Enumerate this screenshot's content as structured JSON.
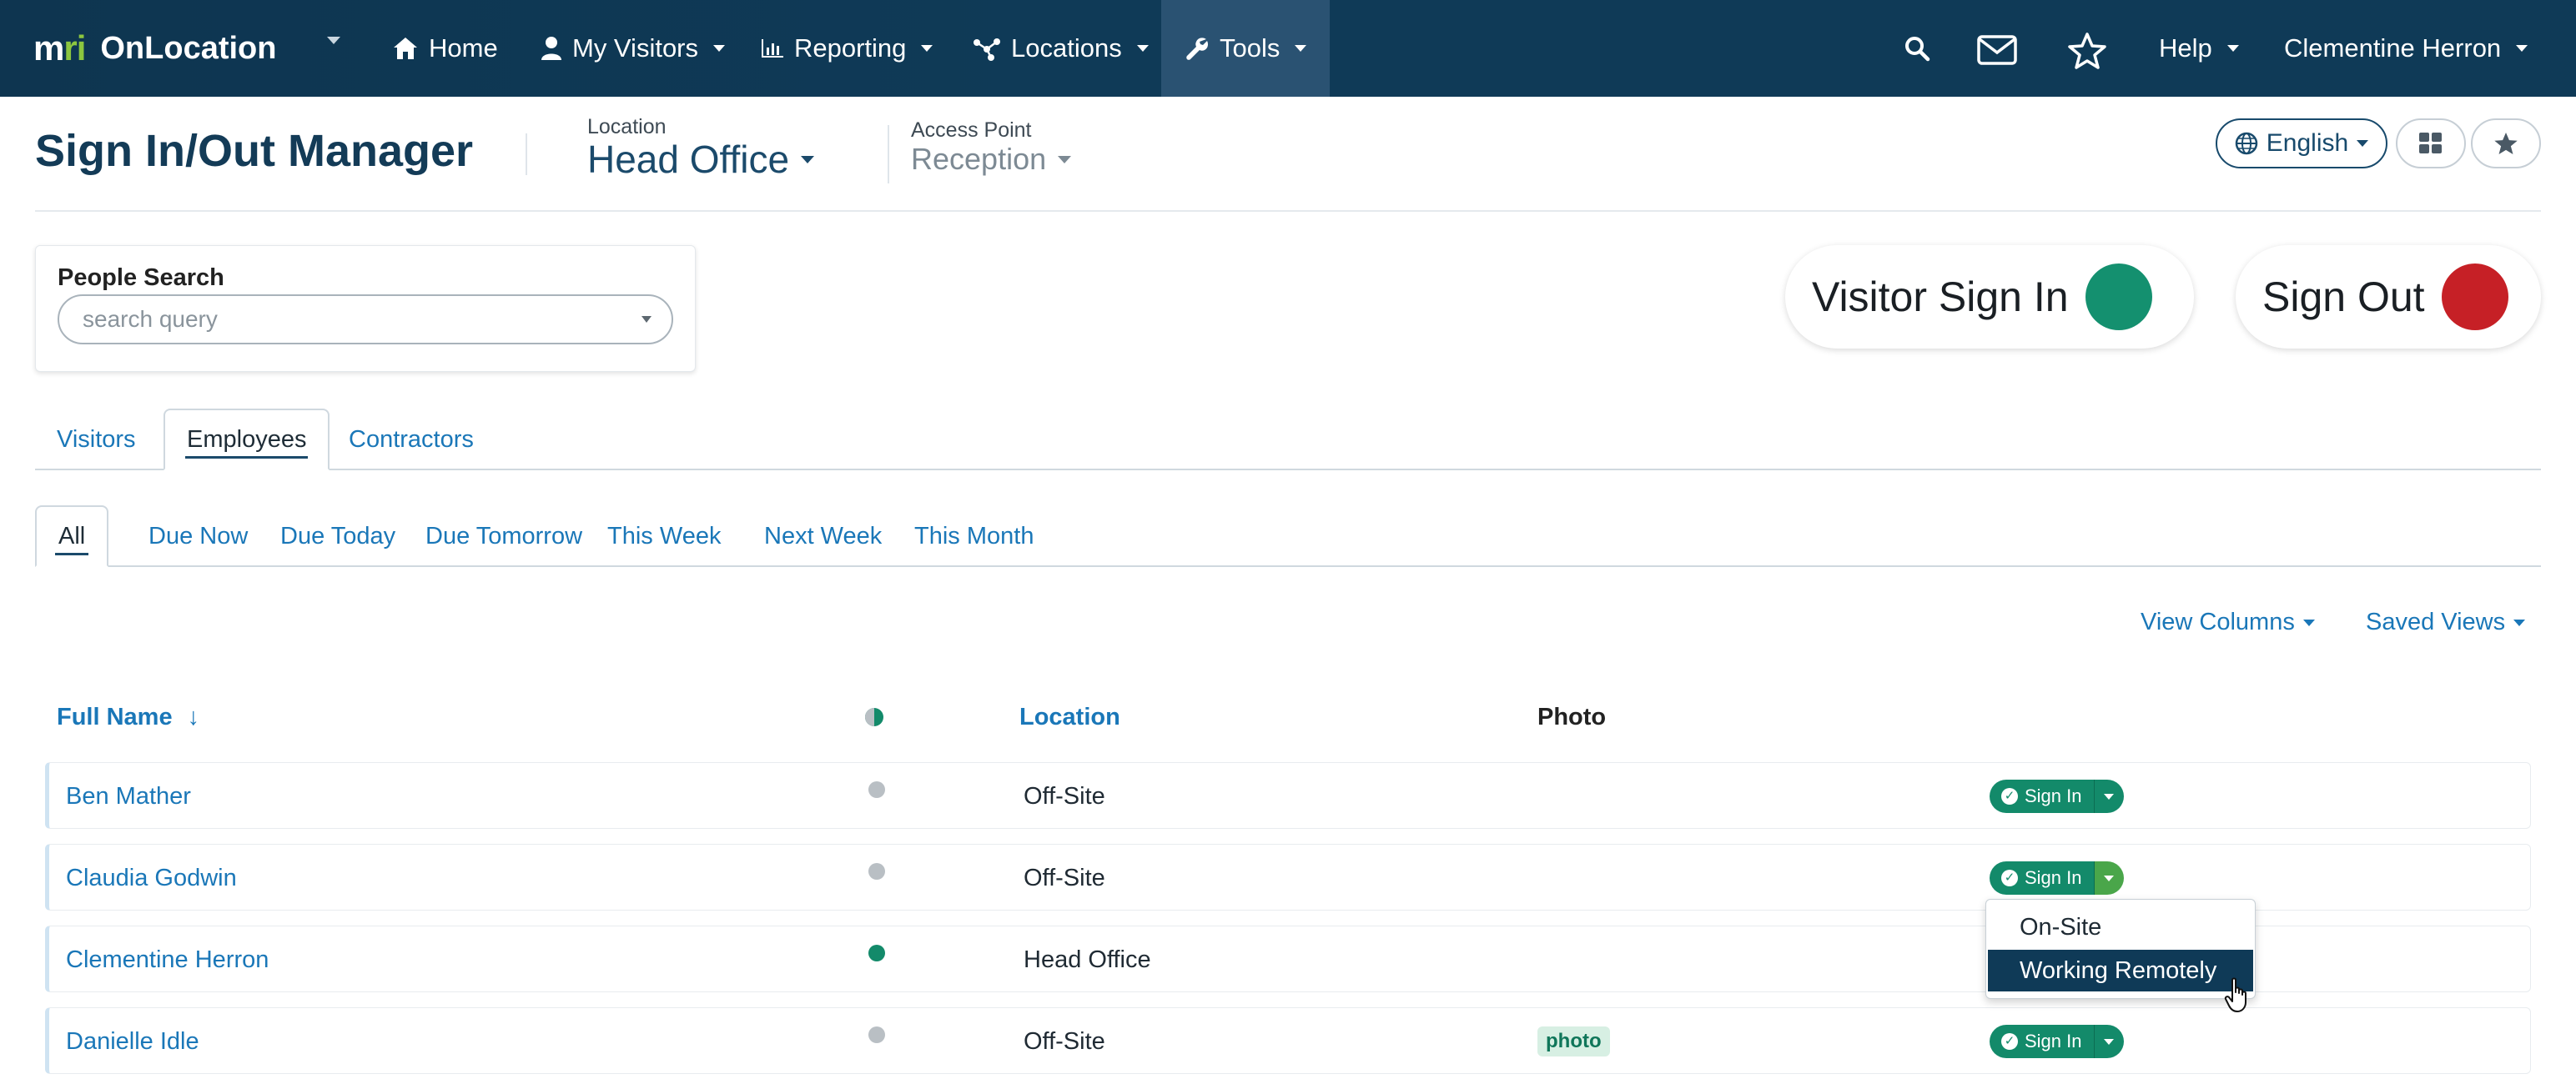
{
  "nav": {
    "brand_mark_a": "m",
    "brand_mark_b": "ri",
    "brand_name": "OnLocation",
    "items": [
      {
        "label": "Home",
        "icon": "home-icon"
      },
      {
        "label": "My Visitors",
        "icon": "user-icon"
      },
      {
        "label": "Reporting",
        "icon": "bar-chart-icon"
      },
      {
        "label": "Locations",
        "icon": "network-icon"
      },
      {
        "label": "Tools",
        "icon": "wrench-icon"
      }
    ],
    "help_label": "Help",
    "user_name": "Clementine Herron"
  },
  "header": {
    "title": "Sign In/Out Manager",
    "location_label": "Location",
    "location_value": "Head Office",
    "access_point_label": "Access Point",
    "access_point_value": "Reception",
    "language": "English"
  },
  "search": {
    "label": "People Search",
    "placeholder": "search query"
  },
  "actions": {
    "visitor_sign_in": "Visitor Sign In",
    "sign_out": "Sign Out",
    "visitor_color": "#14906f",
    "sign_out_color": "#c62026"
  },
  "tabs": [
    "Visitors",
    "Employees",
    "Contractors"
  ],
  "active_tab": "Employees",
  "filters": [
    "All",
    "Due Now",
    "Due Today",
    "Due Tomorrow",
    "This Week",
    "Next Week",
    "This Month"
  ],
  "active_filter": "All",
  "controls": {
    "view_columns": "View Columns",
    "saved_views": "Saved Views"
  },
  "table": {
    "columns": {
      "full_name": "Full Name",
      "sort_arrow": "↓",
      "location": "Location",
      "photo": "Photo"
    },
    "rows": [
      {
        "name": "Ben Mather",
        "location": "Off-Site",
        "status": "off",
        "photo": "",
        "action": "Sign In"
      },
      {
        "name": "Claudia Godwin",
        "location": "Off-Site",
        "status": "off",
        "photo": "",
        "action": "Sign In"
      },
      {
        "name": "Clementine Herron",
        "location": "Head Office",
        "status": "on",
        "photo": "",
        "action": ""
      },
      {
        "name": "Danielle Idle",
        "location": "Off-Site",
        "status": "off",
        "photo": "photo",
        "action": "Sign In"
      }
    ]
  },
  "dropdown": {
    "items": [
      "On-Site",
      "Working Remotely"
    ],
    "highlighted": "Working Remotely"
  },
  "colors": {
    "nav_bg": "#0f3a57",
    "accent_link": "#1a77b8",
    "success": "#138a6a",
    "status_on": "#138a6a",
    "status_off": "#b9bfc4"
  }
}
